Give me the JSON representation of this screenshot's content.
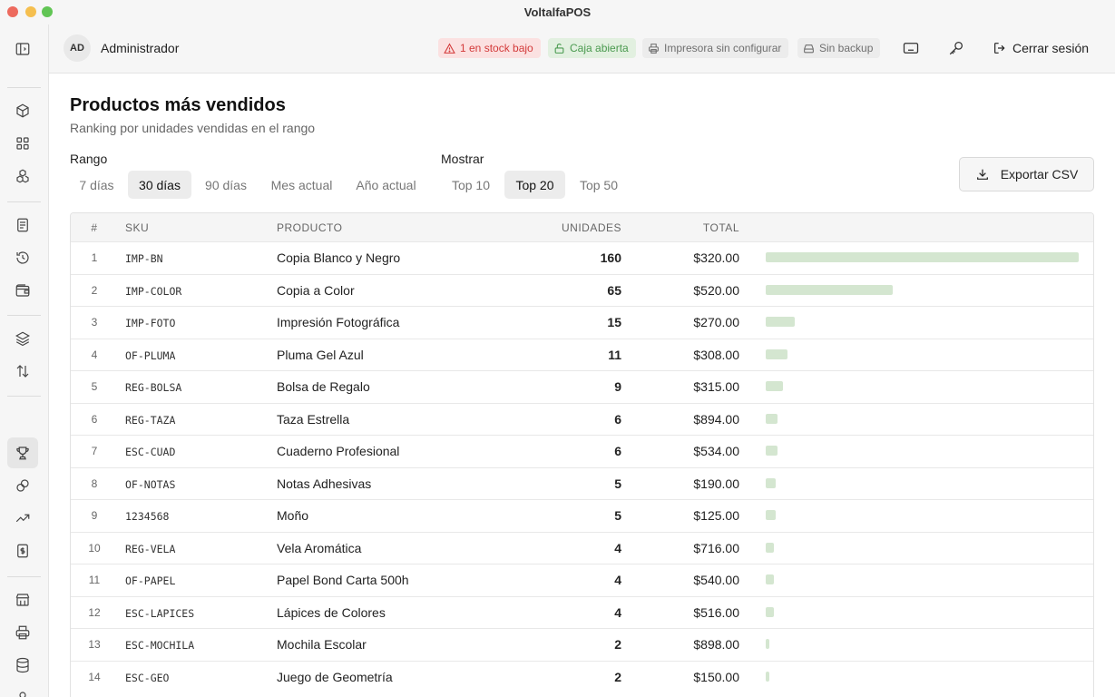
{
  "app": {
    "title": "VoltalfaPOS"
  },
  "header": {
    "avatar_initials": "AD",
    "user_name": "Administrador",
    "badges": {
      "stock": "1 en stock bajo",
      "caja": "Caja abierta",
      "printer": "Impresora sin configurar",
      "backup": "Sin backup"
    },
    "logout_label": "Cerrar sesión"
  },
  "colors": {
    "bar": "#d4e6d0",
    "danger": "#d33a3a",
    "success": "#4a9a4f"
  },
  "page": {
    "title": "Productos más vendidos",
    "subtitle": "Ranking por unidades vendidas en el rango"
  },
  "filters": {
    "range_label": "Rango",
    "range_options": [
      "7 días",
      "30 días",
      "90 días",
      "Mes actual",
      "Año actual"
    ],
    "range_selected": "30 días",
    "show_label": "Mostrar",
    "show_options": [
      "Top 10",
      "Top 20",
      "Top 50"
    ],
    "show_selected": "Top 20",
    "export_label": "Exportar CSV"
  },
  "table": {
    "columns": {
      "num": "#",
      "sku": "SKU",
      "product": "PRODUCTO",
      "units": "UNIDADES",
      "total": "TOTAL"
    },
    "rows": [
      {
        "num": "1",
        "sku": "IMP-BN",
        "product": "Copia Blanco y Negro",
        "units": 160,
        "total": "$320.00"
      },
      {
        "num": "2",
        "sku": "IMP-COLOR",
        "product": "Copia a Color",
        "units": 65,
        "total": "$520.00"
      },
      {
        "num": "3",
        "sku": "IMP-FOTO",
        "product": "Impresión Fotográfica",
        "units": 15,
        "total": "$270.00"
      },
      {
        "num": "4",
        "sku": "OF-PLUMA",
        "product": "Pluma Gel Azul",
        "units": 11,
        "total": "$308.00"
      },
      {
        "num": "5",
        "sku": "REG-BOLSA",
        "product": "Bolsa de Regalo",
        "units": 9,
        "total": "$315.00"
      },
      {
        "num": "6",
        "sku": "REG-TAZA",
        "product": "Taza Estrella",
        "units": 6,
        "total": "$894.00"
      },
      {
        "num": "7",
        "sku": "ESC-CUAD",
        "product": "Cuaderno Profesional",
        "units": 6,
        "total": "$534.00"
      },
      {
        "num": "8",
        "sku": "OF-NOTAS",
        "product": "Notas Adhesivas",
        "units": 5,
        "total": "$190.00"
      },
      {
        "num": "9",
        "sku": "1234568",
        "product": "Moño",
        "units": 5,
        "total": "$125.00"
      },
      {
        "num": "10",
        "sku": "REG-VELA",
        "product": "Vela Aromática",
        "units": 4,
        "total": "$716.00"
      },
      {
        "num": "11",
        "sku": "OF-PAPEL",
        "product": "Papel Bond Carta 500h",
        "units": 4,
        "total": "$540.00"
      },
      {
        "num": "12",
        "sku": "ESC-LAPICES",
        "product": "Lápices de Colores",
        "units": 4,
        "total": "$516.00"
      },
      {
        "num": "13",
        "sku": "ESC-MOCHILA",
        "product": "Mochila Escolar",
        "units": 2,
        "total": "$898.00"
      },
      {
        "num": "14",
        "sku": "ESC-GEO",
        "product": "Juego de Geometría",
        "units": 2,
        "total": "$150.00"
      }
    ]
  }
}
